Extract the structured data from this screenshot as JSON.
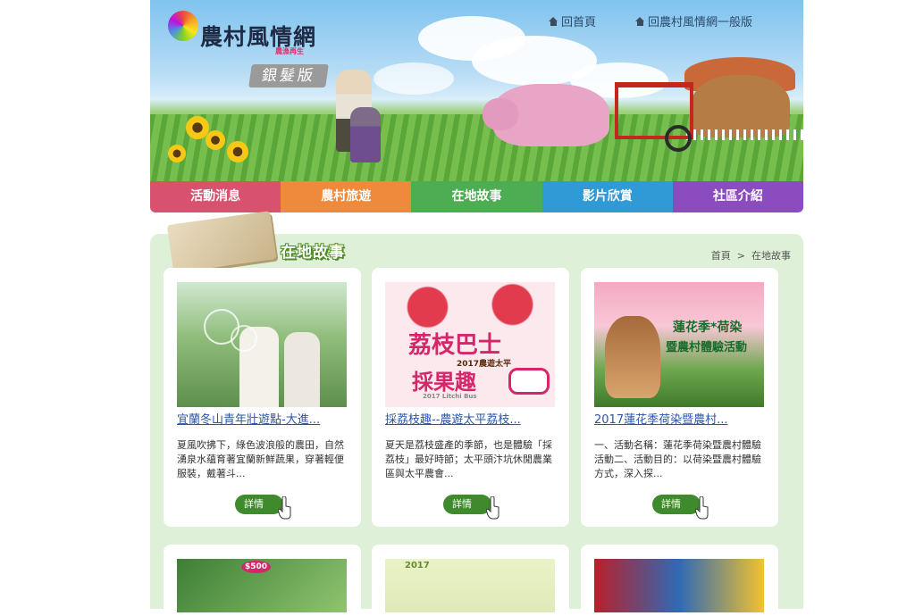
{
  "site": {
    "logo_text": "農村風情網",
    "logo_sub": "農漁再生",
    "edition": "銀髮版",
    "links": [
      "回首頁",
      "回農村風情網一般版"
    ]
  },
  "nav": {
    "items": [
      {
        "label": "活動消息",
        "color": "#d8516f"
      },
      {
        "label": "農村旅遊",
        "color": "#ef8a3c"
      },
      {
        "label": "在地故事",
        "color": "#4cad52"
      },
      {
        "label": "影片欣賞",
        "color": "#2f9ad6"
      },
      {
        "label": "社區介紹",
        "color": "#8a4cbf"
      }
    ]
  },
  "section": {
    "title": "在地故事",
    "breadcrumb": [
      "首頁",
      ">",
      "在地故事"
    ]
  },
  "cards": [
    {
      "title": "宜蘭冬山青年壯遊點-大進...",
      "desc": "夏風吹拂下，綠色波浪般的農田，自然湧泉水蘊育著宜蘭新鮮蔬果，穿著輕便服裝，戴著斗...",
      "button": "詳情"
    },
    {
      "title": "採荔枝趣--農遊太平荔枝...",
      "desc": "夏天是荔枝盛產的季節，也是體驗「採荔枝」最好時節；太平頭汴坑休閒農業區與太平農會...",
      "button": "詳情",
      "image_text": [
        "荔枝巴士",
        "採果趣",
        "2017農遊太平",
        "2017 Litchi Bus"
      ]
    },
    {
      "title": "2017蓮花季荷染暨農村...",
      "desc": "一、活動名稱：蓮花季荷染暨農村體驗活動二、活動目的：以荷染暨農村體驗方式，深入探...",
      "button": "詳情",
      "image_text": [
        "蓮花季*荷染",
        "暨農村體驗活動"
      ]
    }
  ],
  "row2_image_text": [
    "2017",
    "$500"
  ],
  "colors": {
    "content_bg": "#dff0d8",
    "button_green": "#3f8a2c",
    "link_blue": "#2a56a8"
  }
}
